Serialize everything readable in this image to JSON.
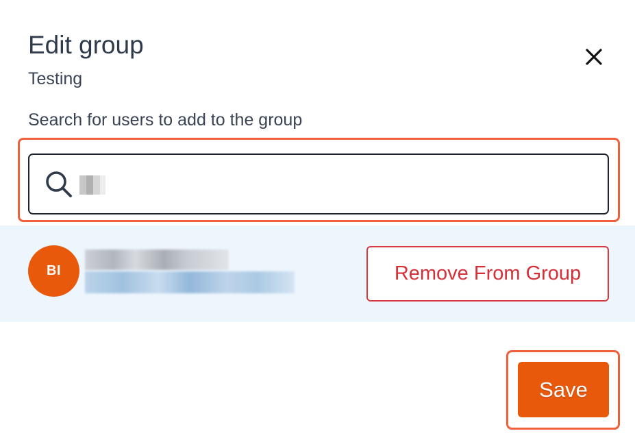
{
  "dialog": {
    "title": "Edit group",
    "subtitle": "Testing",
    "close_icon": "close-icon"
  },
  "search": {
    "label": "Search for users to add to the group",
    "icon": "search-icon",
    "value": ""
  },
  "members": [
    {
      "initials": "BI",
      "avatar_color": "#e8590c",
      "remove_label": "Remove From Group"
    }
  ],
  "footer": {
    "save_label": "Save"
  },
  "colors": {
    "accent": "#e8590c",
    "danger": "#d62f37",
    "row_highlight": "#eef6fd",
    "annotation": "#f0603a"
  }
}
